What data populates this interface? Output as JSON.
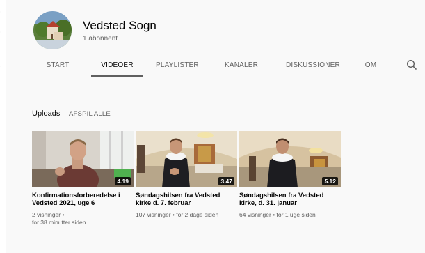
{
  "channel": {
    "name": "Vedsted Sogn",
    "subscribers": "1 abonnent"
  },
  "tabs": [
    {
      "label": "START"
    },
    {
      "label": "VIDEOER"
    },
    {
      "label": "PLAYLISTER"
    },
    {
      "label": "KANALER"
    },
    {
      "label": "DISKUSSIONER"
    },
    {
      "label": "OM"
    }
  ],
  "active_tab": "VIDEOER",
  "shelf": {
    "title": "Uploads",
    "play_all": "AFSPIL ALLE"
  },
  "videos": [
    {
      "title": "Konfirmationsforberedelse i Vedsted 2021, uge 6",
      "views": "2 visninger •",
      "age": "for 38 minutter siden",
      "duration": "4.19"
    },
    {
      "title": "Søndagshilsen fra Vedsted kirke d. 7. februar",
      "meta": "107 visninger • for 2 dage siden",
      "duration": "3.47"
    },
    {
      "title": "Søndagshilsen fra Vedsted kirke, d. 31. januar",
      "meta": "64 visninger • for 1 uge siden",
      "duration": "5.12"
    }
  ],
  "icons": {
    "search": "search-icon"
  },
  "colors": {
    "background": "#f9f9f9",
    "text_primary": "#030303",
    "text_secondary": "#606060"
  }
}
